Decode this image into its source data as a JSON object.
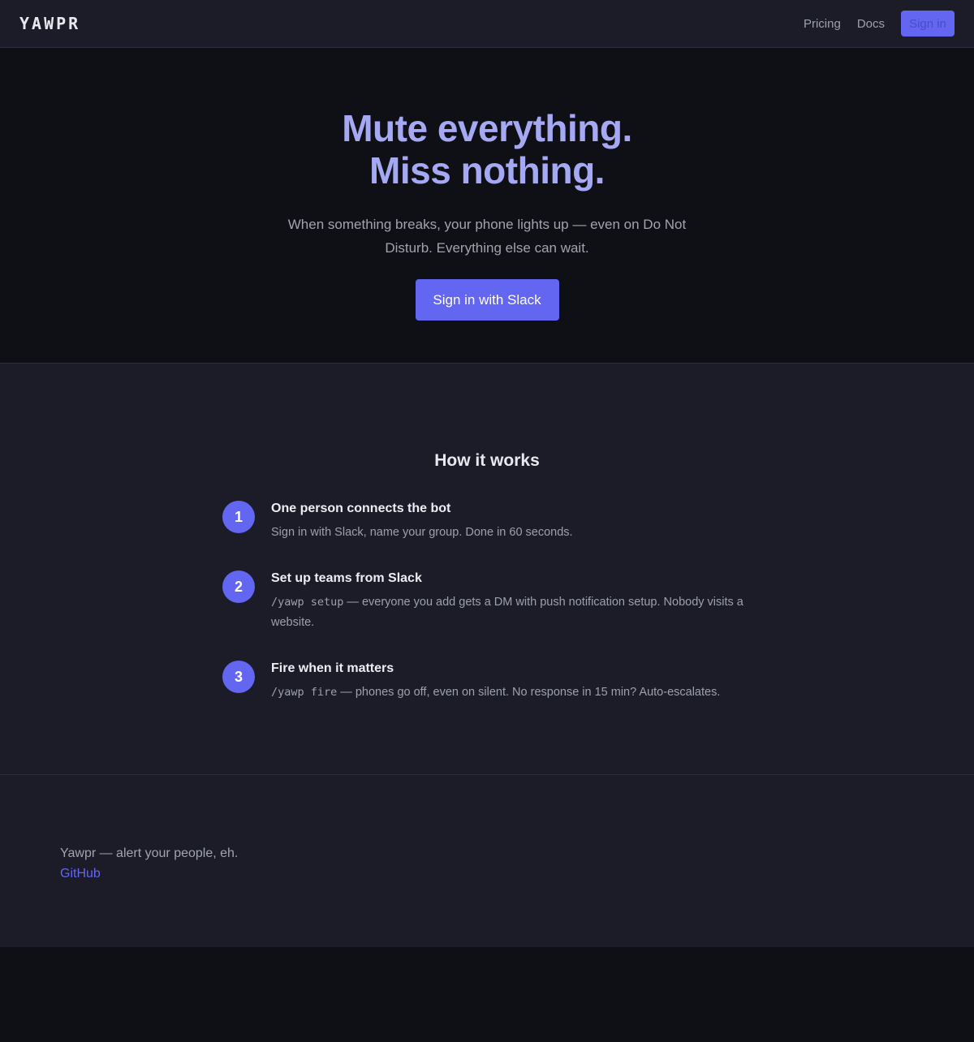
{
  "nav": {
    "logo": "YAWPR",
    "links": [
      "Pricing",
      "Docs"
    ],
    "signin_label": "Sign in"
  },
  "hero": {
    "title_line1": "Mute everything.",
    "title_line2": "Miss nothing.",
    "subtitle": "When something breaks, your phone lights up — even on Do Not Disturb. Everything else can wait.",
    "cta_label": "Sign in with Slack"
  },
  "how": {
    "title": "How it works",
    "steps": [
      {
        "number": "1",
        "title": "One person connects the bot",
        "code": "",
        "desc": "Sign in with Slack, name your group. Done in 60 seconds."
      },
      {
        "number": "2",
        "title": "Set up teams from Slack",
        "code": "/yawp setup",
        "desc": " — everyone you add gets a DM with push notification setup. Nobody visits a website."
      },
      {
        "number": "3",
        "title": "Fire when it matters",
        "code": "/yawp fire",
        "desc": " — phones go off, even on silent. No response in 15 min? Auto-escalates."
      }
    ]
  },
  "footer": {
    "tagline": "Yawpr — alert your people, eh.",
    "link_label": "GitHub"
  },
  "colors": {
    "accent": "#6366f1",
    "hero_title": "#a5a8f3",
    "bg_dark": "#0f1015",
    "bg_panel": "#1b1c28"
  }
}
